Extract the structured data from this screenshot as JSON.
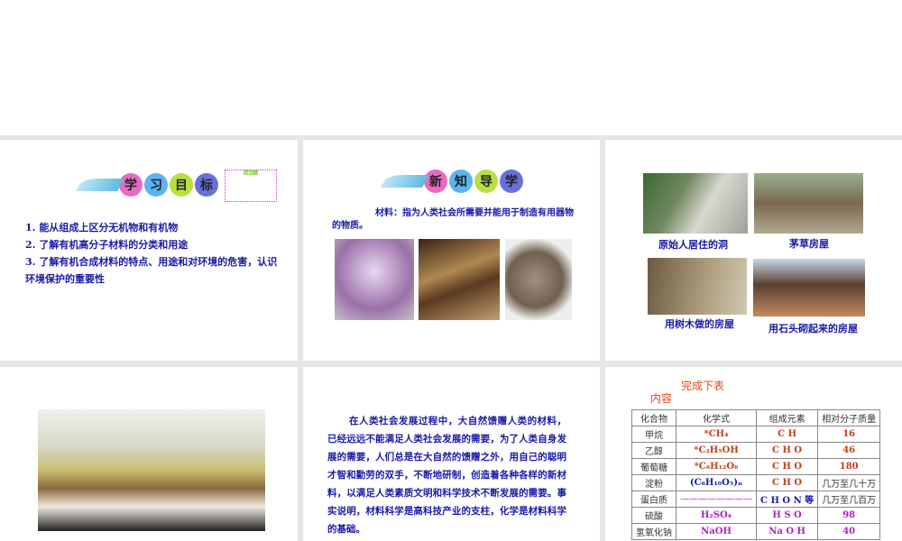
{
  "slide1": {
    "badge": [
      "学",
      "习",
      "目",
      "标"
    ],
    "note": "温馨提示",
    "items": [
      "1. 能从组成上区分无机物和有机物",
      "2. 了解有机高分子材料的分类和用途",
      "3. 了解有机合成材料的特点、用途和对环境的危害，认识",
      "环境保护的重要性"
    ]
  },
  "slide2": {
    "badge": [
      "新",
      "知",
      "导",
      "学"
    ],
    "text": "材料：指为人类社会所需要并能用于制造有用器物的物质。"
  },
  "slide3": {
    "captions": [
      "原始人居住的洞",
      "茅草房屋",
      "用树木做的房屋",
      "用石头砌起来的房屋"
    ]
  },
  "slide5": {
    "text": "在人类社会发展过程中，大自然馈赠人类的材料，已经远远不能满足人类社会发展的需要，为了人类自身发展的需要，人们总是在大自然的馈赠之外，用自己的聪明才智和勤劳的双手，不断地研制，创造着各种各样的新材料，以满足人类素质文明和科学技术不断发展的需要。事实说明，材料科学是高科技产业的支柱，化学是材料科学的基础。"
  },
  "slide6": {
    "title": "完成下表",
    "subtitle": "内容",
    "headers": [
      "化合物",
      "化学式",
      "组成元素",
      "相对分子质量"
    ],
    "rows": [
      [
        "甲烷",
        "*CH₄",
        "C  H",
        "16"
      ],
      [
        "乙醇",
        "*C₂H₅OH",
        "C  H  O",
        "46"
      ],
      [
        "葡萄糖",
        "*C₆H₁₂O₆",
        "C  H  O",
        "180"
      ],
      [
        "淀粉",
        "(C₆H₁₀O₅)ₙ",
        "C  H  O",
        "几万至几十万"
      ],
      [
        "蛋白质",
        "————————",
        "C H O N 等",
        "几万至几百万"
      ],
      [
        "硫酸",
        "H₂SO₄",
        "H  S  O",
        "98"
      ],
      [
        "氢氧化钠",
        "NaOH",
        "Na  O  H",
        "40"
      ]
    ]
  }
}
